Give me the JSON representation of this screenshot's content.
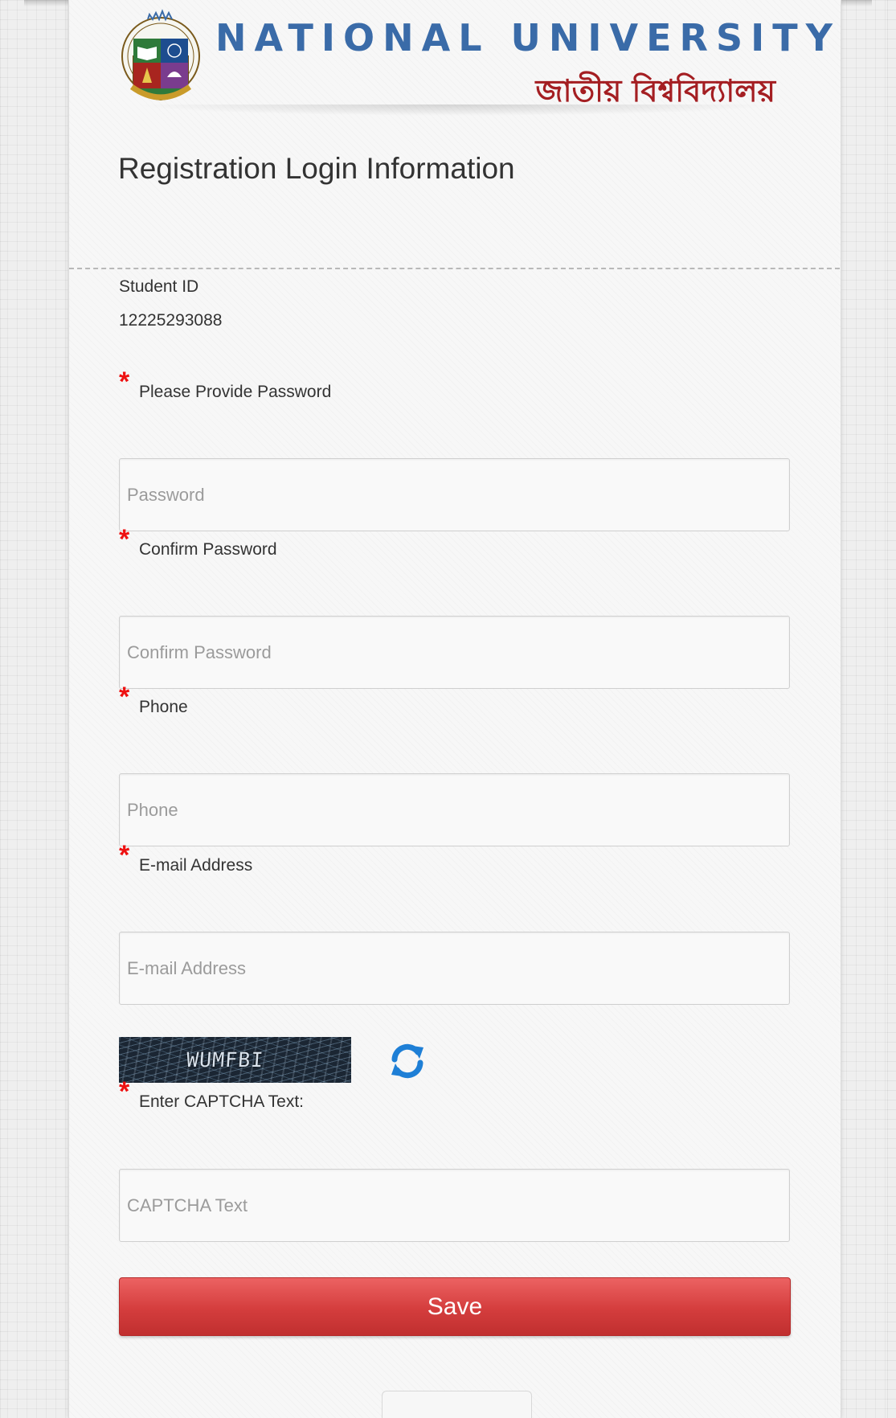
{
  "header": {
    "university_name_en": "NATIONAL UNIVERSITY",
    "university_name_bn": "জাতীয় বিশ্ববিদ্যালয়",
    "logo_icon": "national-university-crest"
  },
  "page": {
    "title": "Registration Login Information"
  },
  "student": {
    "id_label": "Student ID",
    "id_value": "12225293088"
  },
  "form": {
    "required_marker": "*",
    "password": {
      "label": "Please Provide Password",
      "placeholder": "Password",
      "value": ""
    },
    "confirm_password": {
      "label": "Confirm Password",
      "placeholder": "Confirm Password",
      "value": ""
    },
    "phone": {
      "label": "Phone",
      "placeholder": "Phone",
      "value": ""
    },
    "email": {
      "label": "E-mail Address",
      "placeholder": "E-mail Address",
      "value": ""
    },
    "captcha": {
      "image_text": "WUMFBI",
      "refresh_icon": "refresh-arrows-icon",
      "label": "Enter CAPTCHA Text:",
      "placeholder": "CAPTCHA Text",
      "value": ""
    },
    "save_label": "Save"
  },
  "colors": {
    "title_blue": "#3a6ba8",
    "title_red": "#a41e22",
    "required_red": "#ee1111",
    "button_red": "#d43d3d",
    "refresh_blue": "#1e7fd6"
  }
}
